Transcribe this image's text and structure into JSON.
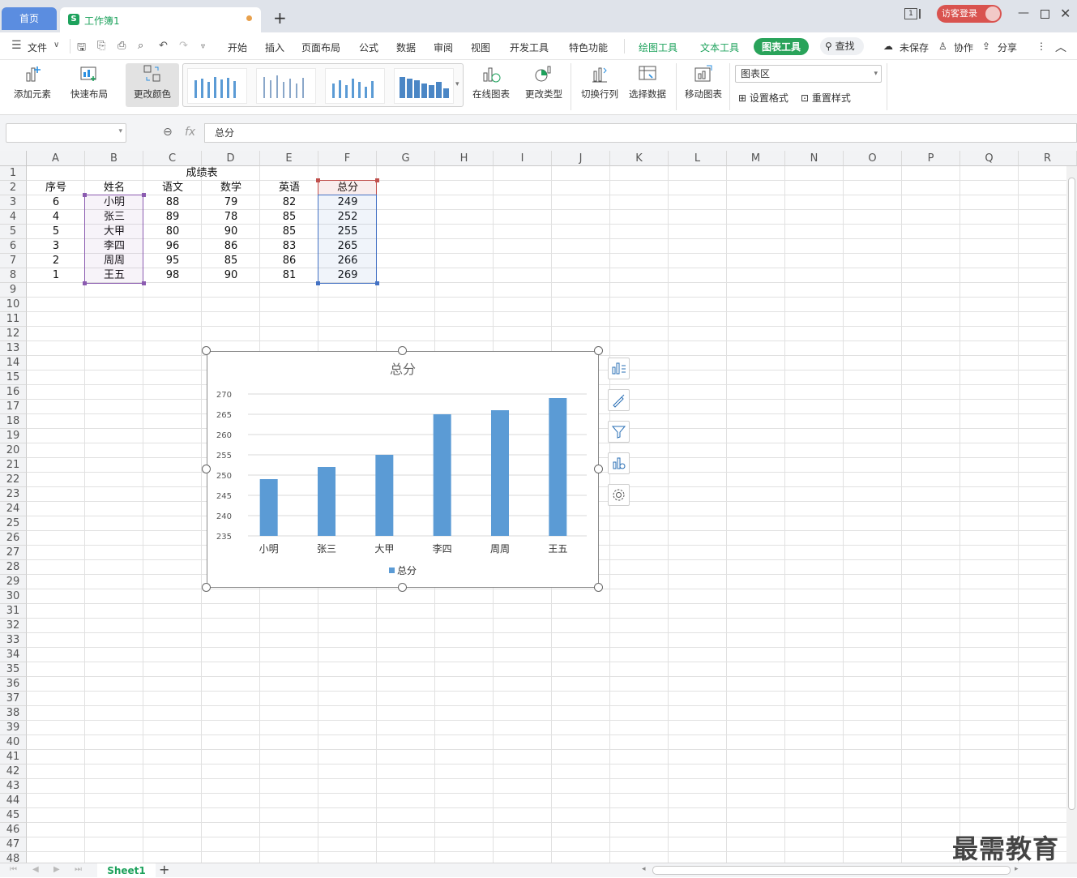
{
  "titlebar": {
    "home_tab": "首页",
    "doc_tab": "工作簿1",
    "doc_logo": "S",
    "new_tab": "+",
    "login": "访客登录",
    "page_indicator": "1"
  },
  "menu": {
    "file": "文件",
    "items": [
      "开始",
      "插入",
      "页面布局",
      "公式",
      "数据",
      "审阅",
      "视图",
      "开发工具",
      "特色功能"
    ],
    "context_tabs": [
      "绘图工具",
      "文本工具",
      "图表工具"
    ],
    "search": "查找",
    "unsaved": "未保存",
    "collab": "协作",
    "share": "分享"
  },
  "ribbon": {
    "add_element": "添加元素",
    "quick_layout": "快速布局",
    "change_color": "更改颜色",
    "online_chart": "在线图表",
    "change_type": "更改类型",
    "switch_rowcol": "切换行列",
    "select_data": "选择数据",
    "move_chart": "移动图表",
    "element_combo": "图表区",
    "set_format": "设置格式",
    "reset_style": "重置样式"
  },
  "formula_bar": {
    "fx": "fx",
    "value": "总分"
  },
  "sheet": {
    "columns": [
      "A",
      "B",
      "C",
      "D",
      "E",
      "F",
      "G",
      "H",
      "I",
      "J",
      "K",
      "L",
      "M",
      "N",
      "O",
      "P",
      "Q",
      "R"
    ],
    "title": "成绩表",
    "headers": [
      "序号",
      "姓名",
      "语文",
      "数学",
      "英语",
      "总分"
    ],
    "rows": [
      [
        "6",
        "小明",
        "88",
        "79",
        "82",
        "249"
      ],
      [
        "4",
        "张三",
        "89",
        "78",
        "85",
        "252"
      ],
      [
        "5",
        "大甲",
        "80",
        "90",
        "85",
        "255"
      ],
      [
        "3",
        "李四",
        "96",
        "86",
        "83",
        "265"
      ],
      [
        "2",
        "周周",
        "95",
        "85",
        "86",
        "266"
      ],
      [
        "1",
        "王五",
        "98",
        "90",
        "81",
        "269"
      ]
    ],
    "tab": "Sheet1"
  },
  "chart_data": {
    "type": "bar",
    "title": "总分",
    "categories": [
      "小明",
      "张三",
      "大甲",
      "李四",
      "周周",
      "王五"
    ],
    "series": [
      {
        "name": "总分",
        "values": [
          249,
          252,
          255,
          265,
          266,
          269
        ],
        "color": "#5b9bd5"
      }
    ],
    "ylim": [
      235,
      270
    ],
    "yticks": [
      235,
      240,
      245,
      250,
      255,
      260,
      265,
      270
    ],
    "grid": true,
    "legend": "bottom"
  },
  "watermark": "最需教育"
}
